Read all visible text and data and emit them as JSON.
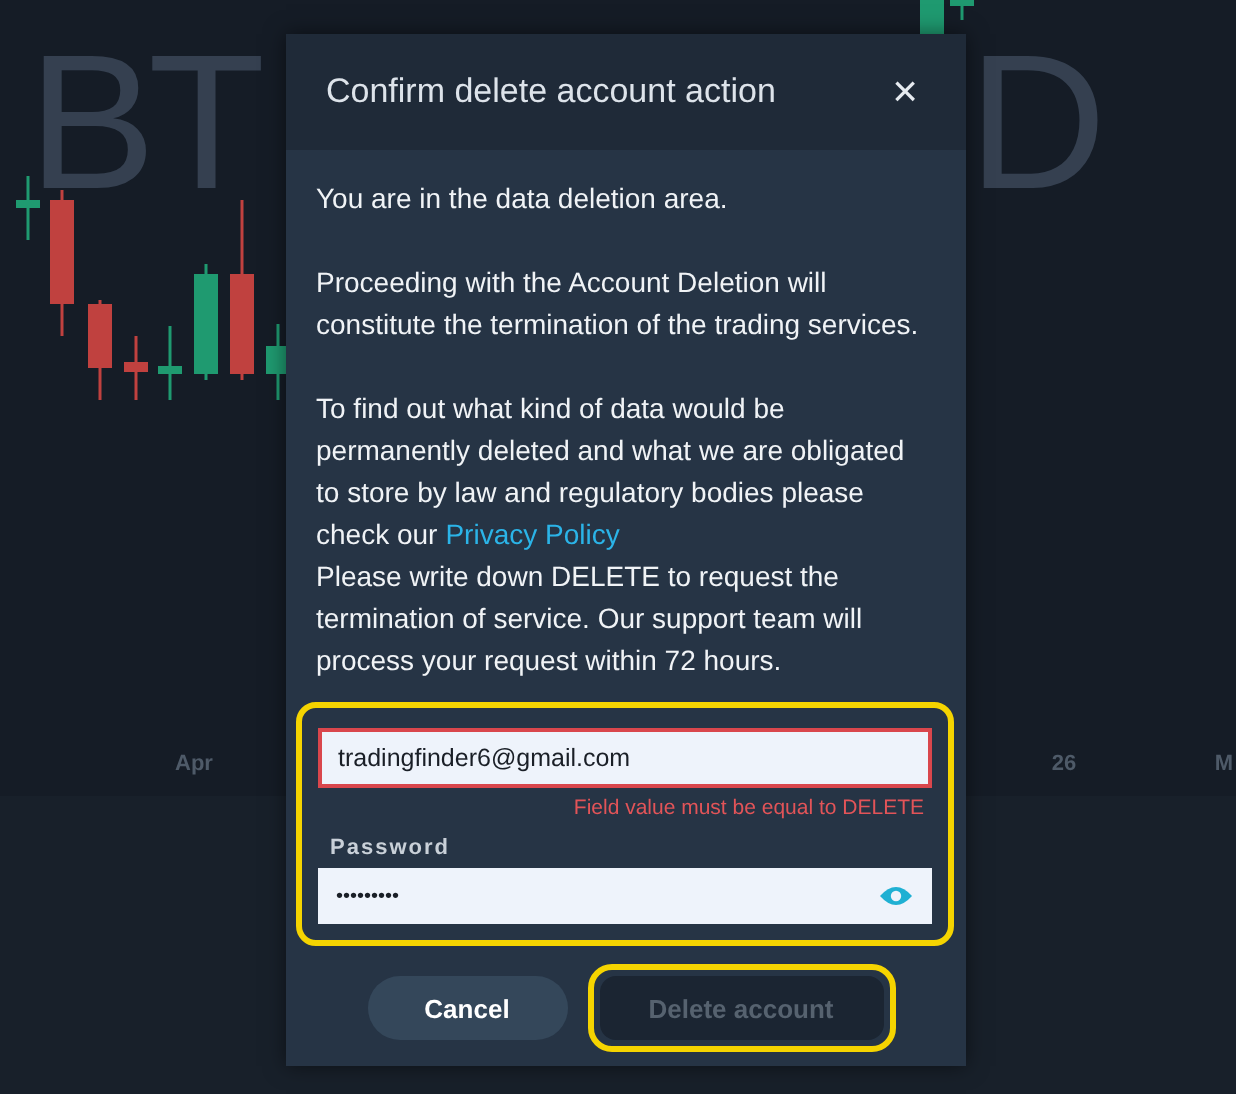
{
  "chart": {
    "symbol_watermark": [
      "BT",
      "D"
    ],
    "x_labels": [
      "Apr",
      "26",
      "M"
    ]
  },
  "dialog": {
    "title": "Confirm delete account action",
    "close": "×",
    "paragraphs": [
      "You are in the data deletion area.",
      "Proceeding with the Account Deletion will constitute the termination of the trading services.",
      "To find out what kind of data would be permanently deleted and what we are obligated to store by law and regulatory bodies please check our"
    ],
    "link": "Privacy Policy",
    "instruction": "Please write down DELETE to request the termination of service. Our support team will process your request within 72 hours.",
    "form": {
      "highlighted": true,
      "confirm_field": {
        "value": "tradingfinder6@gmail.com",
        "invalid": true,
        "error": "Field value must be equal to DELETE"
      },
      "password_field": {
        "label": "Password",
        "value": "•••••••••"
      }
    },
    "buttons": [
      {
        "label": "Cancel",
        "kind": "secondary",
        "disabled": false,
        "highlighted": false
      },
      {
        "label": "Delete account",
        "kind": "danger",
        "disabled": true,
        "highlighted": true
      }
    ]
  }
}
